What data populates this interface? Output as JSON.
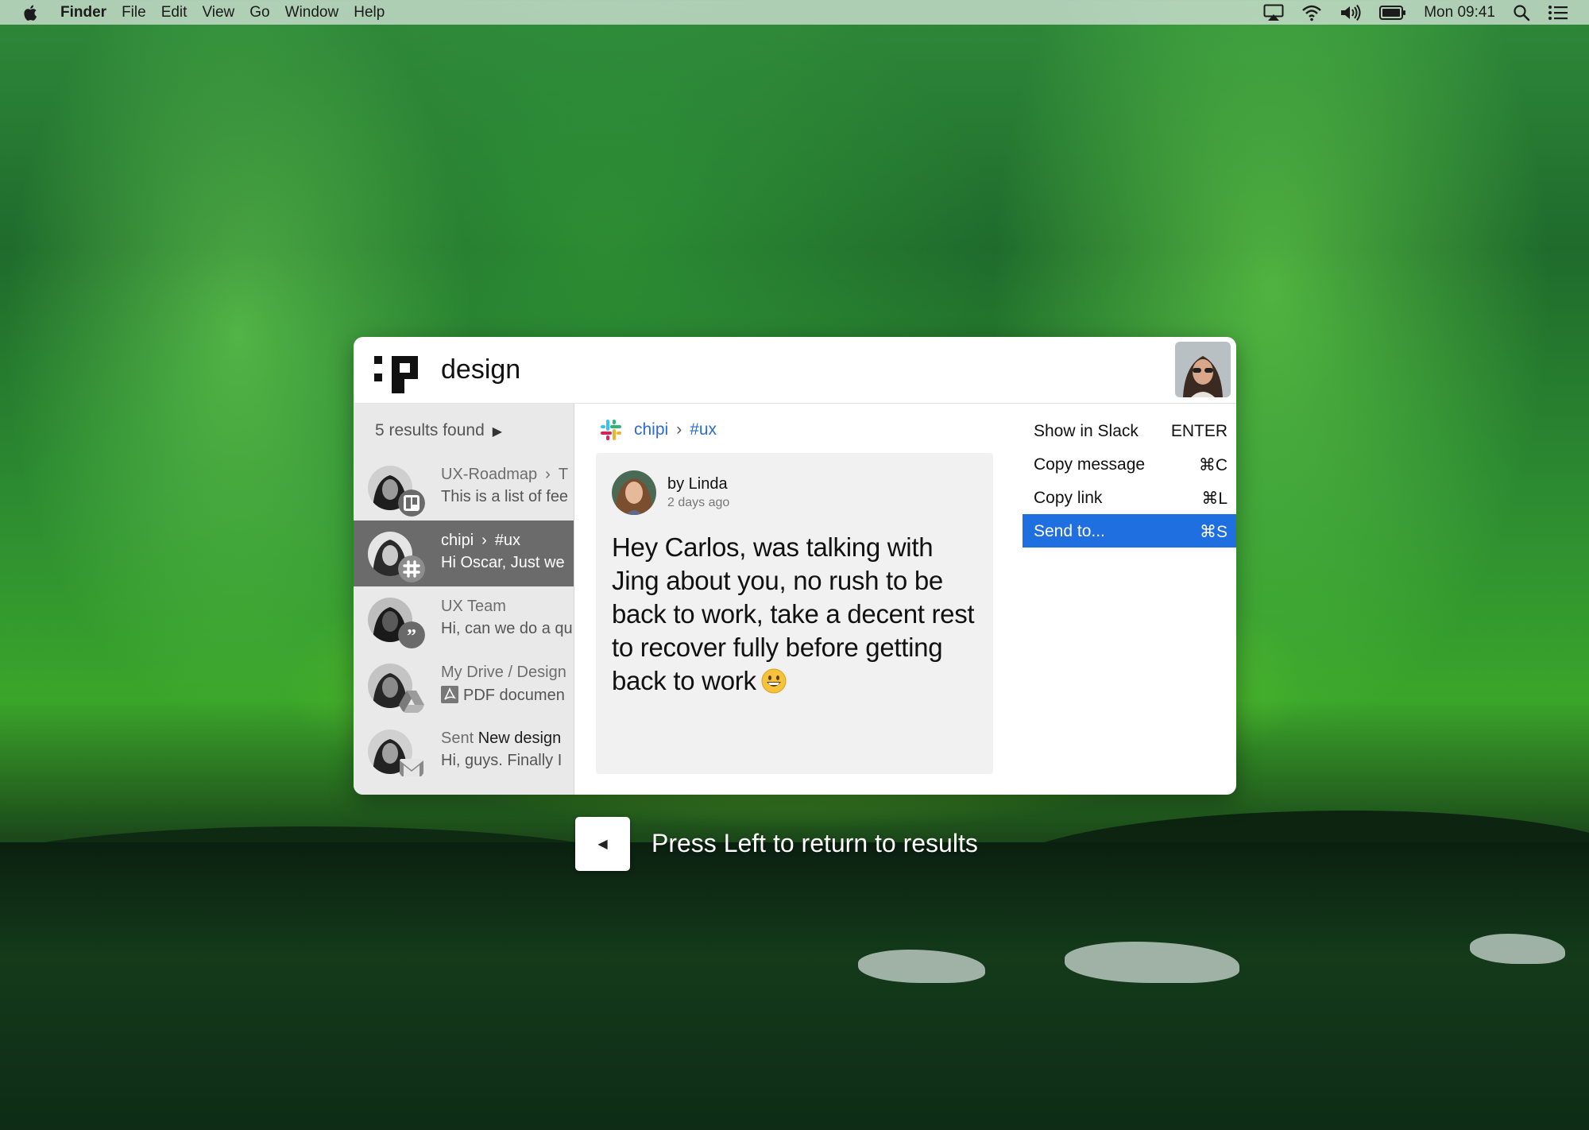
{
  "menubar": {
    "app": "Finder",
    "items": [
      "File",
      "Edit",
      "View",
      "Go",
      "Window",
      "Help"
    ],
    "clock": "Mon 09:41",
    "status_icons": [
      "airplay-icon",
      "wifi-icon",
      "volume-icon",
      "battery-icon",
      "spotlight-icon",
      "notification-center-icon"
    ]
  },
  "search": {
    "query": "design"
  },
  "results": {
    "count_label": "5 results found",
    "items": [
      {
        "title": "UX-Roadmap",
        "title_suffix": "T",
        "subtitle": "This is a list of fee",
        "source": "trello-icon"
      },
      {
        "title": "chipi",
        "title_suffix": "#ux",
        "subtitle": "Hi Oscar, Just we",
        "source": "slack-icon"
      },
      {
        "title": "UX Team",
        "subtitle": "Hi, can we do a qu",
        "source": "hangouts-icon"
      },
      {
        "title": "My Drive / Design",
        "subtitle": "PDF documen",
        "source": "google-drive-icon"
      },
      {
        "title_prefix": "Sent",
        "title": "New design",
        "subtitle": "Hi, guys. Finally I",
        "source": "gmail-icon"
      }
    ]
  },
  "detail": {
    "workspace": "chipi",
    "channel": "#ux",
    "author": "by Linda",
    "time": "2 days ago",
    "message": "Hey Carlos, was talking with Jing about you, no rush to be back to work, take a decent rest to recover fully before getting back to work"
  },
  "actions": [
    {
      "label": "Show in Slack",
      "shortcut": "ENTER"
    },
    {
      "label": "Copy message",
      "shortcut": "⌘C"
    },
    {
      "label": "Copy link",
      "shortcut": "⌘L"
    },
    {
      "label": "Send to...",
      "shortcut": "⌘S"
    }
  ],
  "hint": {
    "key": "◀",
    "text": "Press Left to return to results"
  },
  "colors": {
    "accent": "#1f6fe0",
    "link": "#2c6bd6",
    "active_row": "#6b6b6b"
  }
}
